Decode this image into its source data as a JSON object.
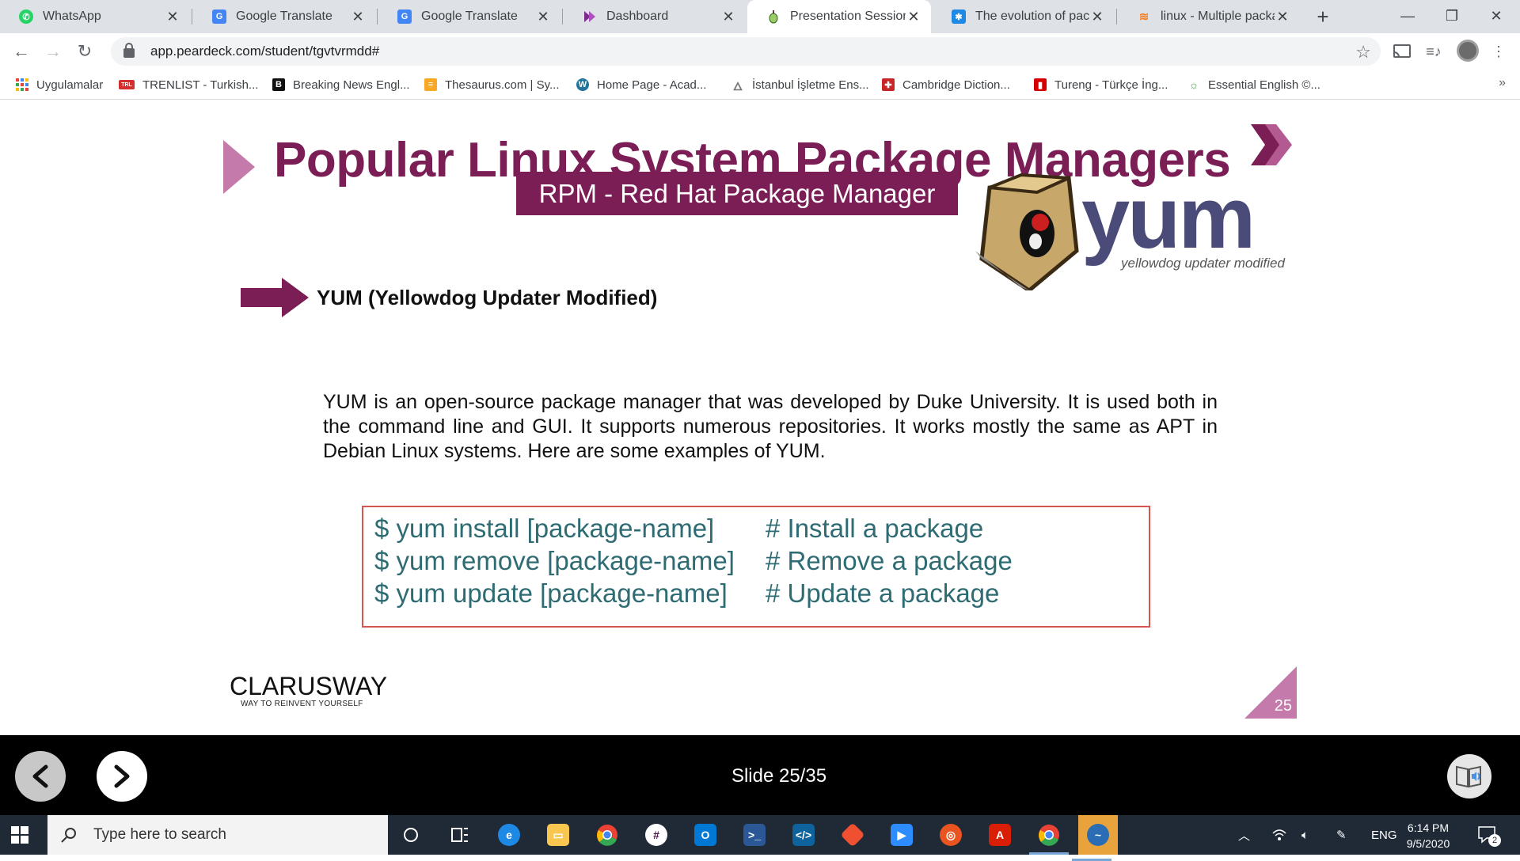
{
  "browser": {
    "tabs": [
      {
        "label": "WhatsApp",
        "icon": "whatsapp-icon",
        "color": "#25d366",
        "active": false
      },
      {
        "label": "Google Translate",
        "icon": "google-translate-icon",
        "color": "#4285f4",
        "active": false
      },
      {
        "label": "Google Translate",
        "icon": "google-translate-icon",
        "color": "#4285f4",
        "active": false
      },
      {
        "label": "Dashboard",
        "icon": "dashboard-icon",
        "color": "#7b2a8c",
        "active": false
      },
      {
        "label": "Presentation Session St",
        "icon": "peardeck-icon",
        "color": "#8bc34a",
        "active": true
      },
      {
        "label": "The evolution of packa",
        "icon": "snowflake-icon",
        "color": "#1e88e5",
        "active": false
      },
      {
        "label": "linux - Multiple packag",
        "icon": "stackoverflow-icon",
        "color": "#f48024",
        "active": false
      }
    ],
    "url": "app.peardeck.com/student/tgvtvrmdd#",
    "bookmarks": [
      {
        "label": "Uygulamalar",
        "icon": "apps-grid-icon",
        "color": "#ea4335"
      },
      {
        "label": "TRENLIST - Turkish...",
        "icon": "trenlist-icon",
        "color": "#d32f2f"
      },
      {
        "label": "Breaking News Engl...",
        "icon": "breaking-news-icon",
        "color": "#111111"
      },
      {
        "label": "Thesaurus.com | Sy...",
        "icon": "thesaurus-icon",
        "color": "#f9a825"
      },
      {
        "label": "Home Page - Acad...",
        "icon": "wordpress-icon",
        "color": "#21759b"
      },
      {
        "label": "İstanbul İşletme Ens...",
        "icon": "torch-icon",
        "color": "#777777"
      },
      {
        "label": "Cambridge Diction...",
        "icon": "cambridge-icon",
        "color": "#c62828"
      },
      {
        "label": "Tureng - Türkçe İng...",
        "icon": "tureng-icon",
        "color": "#d50000"
      },
      {
        "label": "Essential English ©...",
        "icon": "essential-english-icon",
        "color": "#43a047"
      }
    ]
  },
  "slide": {
    "title": "Popular Linux System Package Managers",
    "banner": "RPM - Red Hat Package Manager",
    "subtitle": "YUM (Yellowdog Updater Modified)",
    "logo_word": "yum",
    "logo_tagline": "yellowdog updater modified",
    "body": "YUM is an open-source package manager that was developed by Duke University. It is used both in the command line and GUI. It supports numerous repositories. It works mostly the same as APT in Debian Linux systems. Here are some examples of YUM.",
    "commands": [
      {
        "cmd": "$ yum install [package-name]",
        "comment": "# Install a package"
      },
      {
        "cmd": "$ yum remove [package-name]",
        "comment": "# Remove a package"
      },
      {
        "cmd": "$ yum update [package-name]",
        "comment": "# Update a package"
      }
    ],
    "brand": "CLARUSWAY",
    "brand_tagline": "WAY TO REINVENT YOURSELF",
    "page_number": "25",
    "accent_color": "#7b1e56"
  },
  "peardeck": {
    "slide_counter": "Slide 25/35"
  },
  "taskbar": {
    "search_placeholder": "Type here to search",
    "language": "ENG",
    "time": "6:14 PM",
    "date": "9/5/2020",
    "notifications": "2"
  }
}
